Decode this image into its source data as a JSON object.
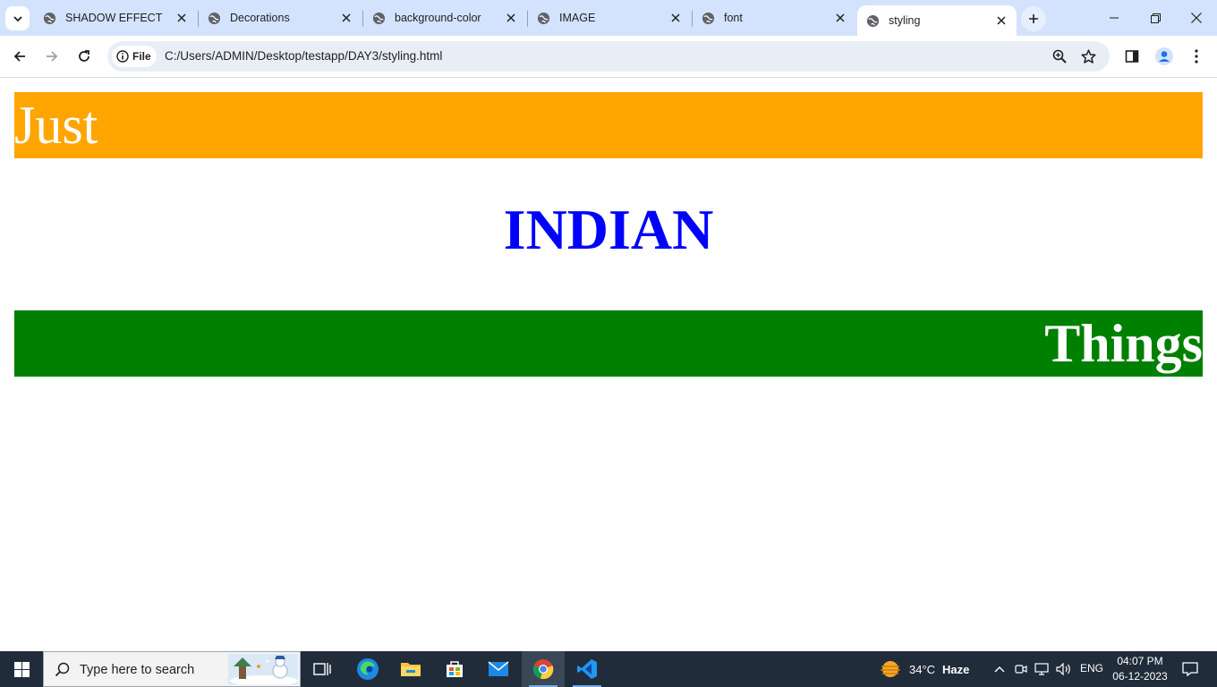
{
  "browser": {
    "tabs": [
      {
        "title": "SHADOW EFFECT",
        "active": false
      },
      {
        "title": "Decorations",
        "active": false
      },
      {
        "title": "background-color",
        "active": false
      },
      {
        "title": "IMAGE",
        "active": false
      },
      {
        "title": "font",
        "active": false
      },
      {
        "title": "styling",
        "active": true
      }
    ],
    "address": {
      "scheme_label": "File",
      "url": "C:/Users/ADMIN/Desktop/testapp/DAY3/styling.html"
    }
  },
  "page": {
    "top_band": {
      "text": "Just",
      "color": "#ffa500"
    },
    "middle": {
      "text": "INDIAN",
      "color": "#0000ff"
    },
    "bottom_band": {
      "text": "Things",
      "color": "#008000"
    }
  },
  "taskbar": {
    "search_placeholder": "Type here to search",
    "apps": [
      "task-view",
      "edge",
      "file-explorer",
      "microsoft-store",
      "mail",
      "chrome",
      "vscode"
    ],
    "weather": {
      "temp": "34°C",
      "condition": "Haze"
    },
    "language": "ENG",
    "time": "04:07 PM",
    "date": "06-12-2023"
  }
}
